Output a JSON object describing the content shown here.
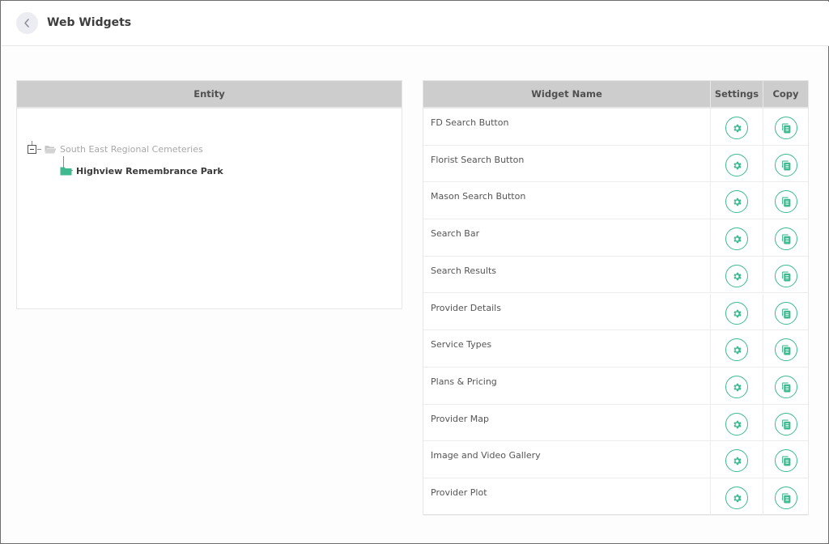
{
  "header": {
    "title": "Web Widgets",
    "back_icon": "chevron-left-icon"
  },
  "entity_panel": {
    "column_header": "Entity",
    "tree": {
      "root": {
        "label": "South East Regional Cemeteries",
        "icon": "folder-open-icon",
        "expanded": true
      },
      "children": [
        {
          "label": "Highview Remembrance Park",
          "icon": "folder-icon",
          "selected": true
        }
      ]
    }
  },
  "widgets_table": {
    "columns": {
      "name": "Widget Name",
      "settings": "Settings",
      "copy": "Copy"
    },
    "rows": [
      {
        "name": "FD Search Button"
      },
      {
        "name": "Florist Search Button"
      },
      {
        "name": "Mason Search Button"
      },
      {
        "name": "Search Bar"
      },
      {
        "name": "Search Results"
      },
      {
        "name": "Provider Details"
      },
      {
        "name": "Service Types"
      },
      {
        "name": "Plans & Pricing"
      },
      {
        "name": "Provider Map"
      },
      {
        "name": "Image and Video Gallery"
      },
      {
        "name": "Provider Plot"
      }
    ],
    "settings_icon": "gear-icon",
    "copy_icon": "copy-icon"
  },
  "colors": {
    "accent": "#3fb98f",
    "header_bg": "#cdcdcd",
    "folder_selected": "#3fb98f",
    "folder_root": "#bdbdbd"
  }
}
